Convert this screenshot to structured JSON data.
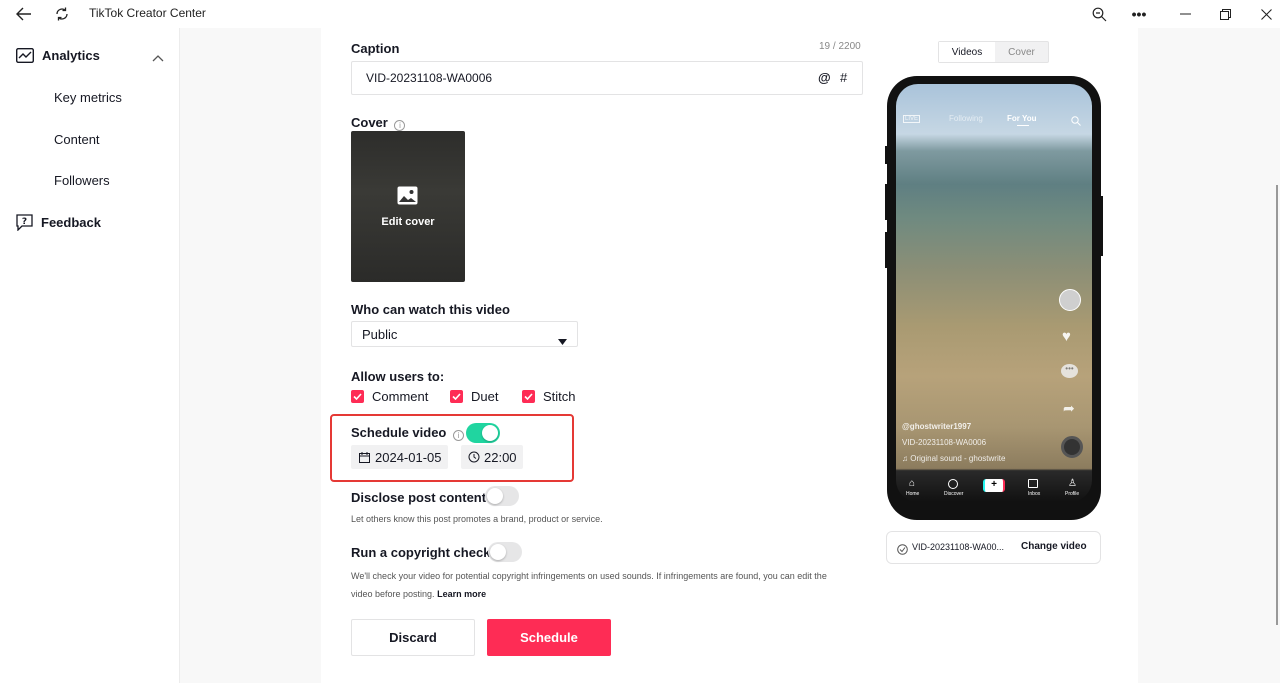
{
  "window": {
    "title": "TikTok Creator Center"
  },
  "sidebar": {
    "items": [
      {
        "label": "Analytics"
      },
      {
        "label": "Key metrics"
      },
      {
        "label": "Content"
      },
      {
        "label": "Followers"
      },
      {
        "label": "Feedback"
      }
    ]
  },
  "caption": {
    "label": "Caption",
    "count": "19 / 2200",
    "value": "VID-20231108-WA0006",
    "at": "@",
    "hash": "#"
  },
  "cover": {
    "label": "Cover",
    "edit_label": "Edit cover"
  },
  "visibility": {
    "label": "Who can watch this video",
    "selected": "Public"
  },
  "allow": {
    "label": "Allow users to:",
    "options": [
      "Comment",
      "Duet",
      "Stitch"
    ]
  },
  "schedule": {
    "label": "Schedule video",
    "enabled": true,
    "date": "2024-01-05",
    "time": "22:00"
  },
  "disclose": {
    "label": "Disclose post content",
    "enabled": false,
    "description": "Let others know this post promotes a brand, product or service."
  },
  "copyright": {
    "label": "Run a copyright check",
    "enabled": false,
    "description": "We'll check your video for potential copyright infringements on used sounds. If infringements are found, you can edit the",
    "description2": "video before posting.",
    "learn_more": "Learn more"
  },
  "actions": {
    "discard": "Discard",
    "schedule": "Schedule"
  },
  "preview": {
    "tabs": [
      "Videos",
      "Cover"
    ],
    "top_tabs": [
      "Following",
      "For You"
    ],
    "live": "LIVE",
    "username": "@ghostwriter1997",
    "caption": "VID-20231108-WA0006",
    "sound": "Original sound - ghostwrite",
    "nav": [
      "Home",
      "Discover",
      "Inbox",
      "Profile"
    ],
    "file_name": "VID-20231108-WA00...",
    "change_video": "Change video"
  },
  "colors": {
    "accent": "#fe2c55",
    "toggle_on": "#20d5a0",
    "highlight_border": "#e53935"
  }
}
